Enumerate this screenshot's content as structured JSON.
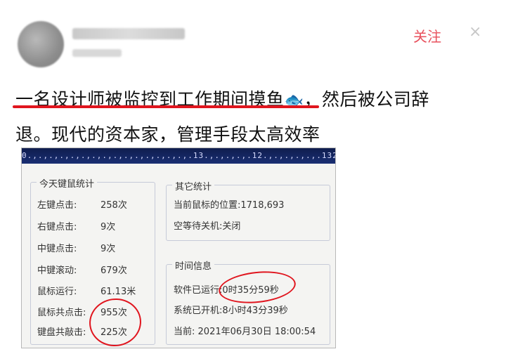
{
  "header": {
    "follow_label": "关注",
    "close_glyph": "×"
  },
  "post": {
    "line1": "一名设计师被监控到工作期间摸鱼",
    "fish_emoji": "🐟",
    "line1_tail": "，然后被公司辞",
    "line2": "退。现代的资本家，管理手段太高效率"
  },
  "screenshot": {
    "taskbar_text": "0.,.,.,.,.,.,.,.,.,.,.,.,.,.,.,.13.,.,.,.,.12.,.,.,.,.,.132.,.,.,.,.,.,.,.,.,.,.,.,.,.,45.,.,.,.,.",
    "today": {
      "title": "今天键鼠统计",
      "rows": [
        {
          "label": "左键点击:",
          "value": "258次"
        },
        {
          "label": "右键点击:",
          "value": "9次"
        },
        {
          "label": "中键点击:",
          "value": "9次"
        },
        {
          "label": "中键滚动:",
          "value": "679次"
        },
        {
          "label": "鼠标运行:",
          "value": "61.13米"
        },
        {
          "label": "鼠标共点击:",
          "value": "955次"
        },
        {
          "label": "键盘共敲击:",
          "value": "225次"
        }
      ]
    },
    "other": {
      "title": "其它统计",
      "mouse_pos": "当前鼠标的位置:1718,693",
      "standby": "空等待关机:关闭"
    },
    "time": {
      "title": "时间信息",
      "software_label": "软件已运行:",
      "software_value": "0时35分59秒",
      "system_on": "系统已开机:8小时43分39秒",
      "current_label": "当前:",
      "current_value": "2021年06月30日  18:00:54"
    }
  }
}
